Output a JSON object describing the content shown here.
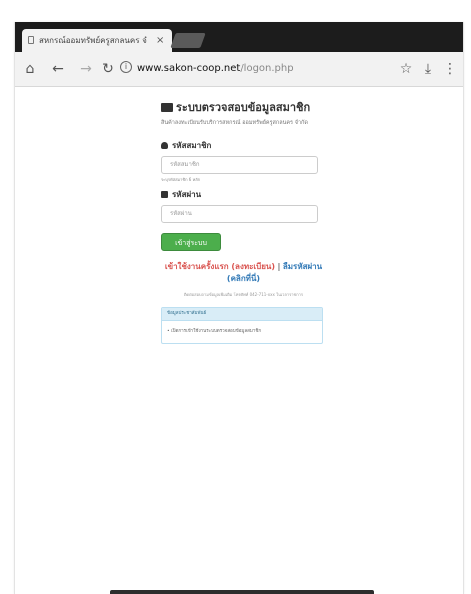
{
  "browser": {
    "tab_title": "สหกรณ์ออมทรัพย์ครูสกลนคร จำ",
    "tab_close": "×",
    "url_domain": "www.sakon-coop.net",
    "url_path": "/logon.php",
    "icons": [
      "home-icon",
      "back-icon",
      "forward-icon",
      "reload-icon",
      "info-icon",
      "star-icon",
      "download-icon",
      "menu-icon"
    ]
  },
  "page": {
    "heading": "ระบบตรวจสอบข้อมูลสมาชิก",
    "subheading": "สินค้าลงทะเบียนรับบริการสหกรณ์ ออมทรัพย์ครูสกลนคร จำกัด",
    "member_label": "รหัสสมาชิก",
    "member_placeholder": "รหัสสมาชิก",
    "member_hint": "ระบุรหัสสมาชิก 6 หลัก",
    "password_label": "รหัสผ่าน",
    "password_placeholder": "รหัสผ่าน",
    "login_button": "เข้าสู่ระบบ",
    "register_link": "เข้าใช้งานครั้งแรก (ลงทะเบียน)",
    "separator": "|",
    "forgot_link": "ลืมรหัสผ่าน (คลิกที่นี่)",
    "note": "ติดต่อสอบถามข้อมูลเพิ่มเติม โทรศัพท์ 042-711-xxx ในเวลาราชการ",
    "notice_title": "ข้อมูลประชาสัมพันธ์",
    "notice_body": "• เปิดการเข้าใช้งานระบบตรวจสอบข้อมูลสมาชิก"
  },
  "colors": {
    "tabbar": "#1c1c1c",
    "button_green": "#4cae4c",
    "link_red": "#d9534f",
    "link_blue": "#337ab7"
  }
}
